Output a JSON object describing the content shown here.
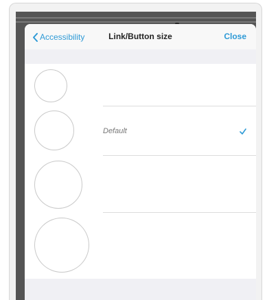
{
  "colors": {
    "accent": "#2e9ad6",
    "sheet_background": "#555555"
  },
  "navbar": {
    "back_label": "Accessibility",
    "title": "Link/Button size",
    "close_label": "Close"
  },
  "size_options": [
    {
      "label": "",
      "selected": false
    },
    {
      "label": "Default",
      "selected": true
    },
    {
      "label": "",
      "selected": false
    },
    {
      "label": "",
      "selected": false
    }
  ],
  "icons": {
    "back": "chevron-left-icon",
    "selected": "checkmark-icon"
  }
}
